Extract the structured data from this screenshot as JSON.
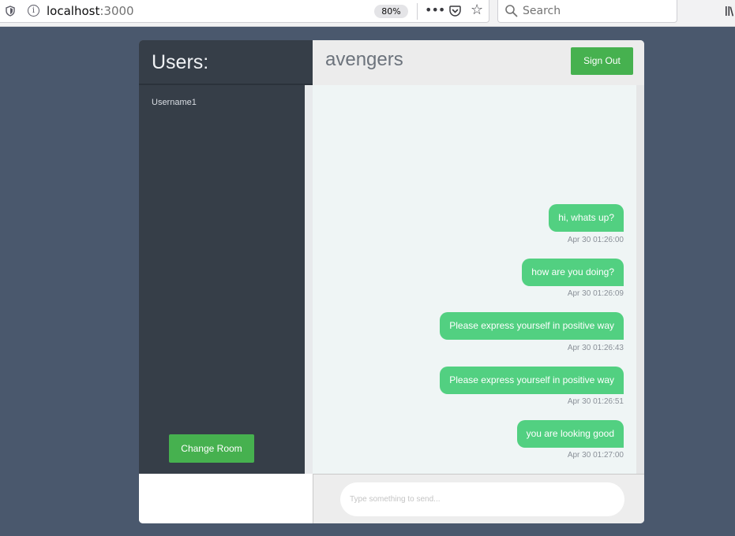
{
  "browser": {
    "url_host": "localhost",
    "url_port": ":3000",
    "zoom": "80%",
    "more_label": "•••",
    "star_glyph": "☆",
    "search_placeholder": "Search"
  },
  "sidebar": {
    "title": "Users:",
    "users": [
      "Username1"
    ],
    "change_room_label": "Change Room"
  },
  "chat": {
    "room_name": "avengers",
    "sign_out_label": "Sign Out",
    "messages": [
      {
        "text": "hi, whats up?",
        "time": "Apr 30 01:26:00"
      },
      {
        "text": "how are you doing?",
        "time": "Apr 30 01:26:09"
      },
      {
        "text": "Please express yourself in positive way",
        "time": "Apr 30 01:26:43"
      },
      {
        "text": "Please express yourself in positive way",
        "time": "Apr 30 01:26:51"
      },
      {
        "text": "you are looking good",
        "time": "Apr 30 01:27:00"
      }
    ],
    "input_placeholder": "Type something to send..."
  },
  "colors": {
    "page_bg": "#4a586d",
    "sidebar_bg": "#363e48",
    "accent_button": "#46b14f",
    "bubble": "#52d081"
  }
}
